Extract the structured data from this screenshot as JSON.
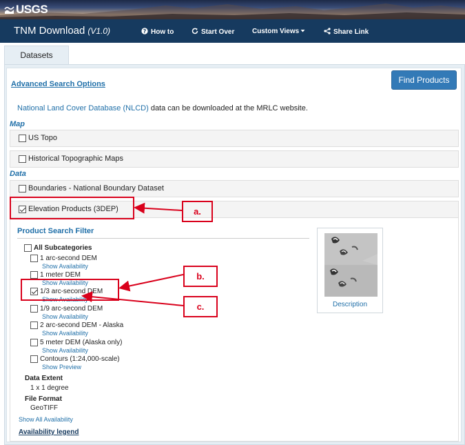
{
  "banner": {
    "logo_text": "USGS"
  },
  "nav": {
    "title": "TNM Download",
    "version": "(V1.0)",
    "links": [
      {
        "icon": "question-circle-icon",
        "label": "How to"
      },
      {
        "icon": "refresh-icon",
        "label": "Start Over"
      },
      {
        "icon": "caret-down-icon",
        "label": "Custom Views"
      },
      {
        "icon": "share-icon",
        "label": "Share Link"
      }
    ]
  },
  "tabs": {
    "datasets": "Datasets"
  },
  "toolbar": {
    "advanced_search": "Advanced Search Options",
    "find_products": "Find Products"
  },
  "nlcd": {
    "link_text": "National Land Cover Database (NLCD)",
    "rest_text": " data can be downloaded at the MRLC website."
  },
  "sections": {
    "map": "Map",
    "data": "Data"
  },
  "datasets": {
    "us_topo": {
      "label": "US Topo",
      "checked": false
    },
    "historical": {
      "label": "Historical Topographic Maps",
      "checked": false
    },
    "boundaries": {
      "label": "Boundaries - National Boundary Dataset",
      "checked": false
    },
    "elevation": {
      "label": "Elevation Products (3DEP)",
      "checked": true
    }
  },
  "filter": {
    "title": "Product Search Filter",
    "all_subcategories": "All Subcategories",
    "items": [
      {
        "label": "1 arc-second DEM",
        "link": "Show Availability",
        "checked": false
      },
      {
        "label": "1 meter DEM",
        "link": "Show Availability",
        "checked": false
      },
      {
        "label": "1/3 arc-second DEM",
        "link": "Show Availability",
        "checked": true
      },
      {
        "label": "1/9 arc-second DEM",
        "link": "Show Availability",
        "checked": false
      },
      {
        "label": "2 arc-second DEM - Alaska",
        "link": "Show Availability",
        "checked": false
      },
      {
        "label": "5 meter DEM (Alaska only)",
        "link": "Show Availability",
        "checked": false
      },
      {
        "label": "Contours (1:24,000-scale)",
        "link": "Show Preview",
        "checked": false
      }
    ],
    "data_extent_label": "Data Extent",
    "data_extent_value": "1 x 1 degree",
    "file_format_label": "File Format",
    "file_format_value": "GeoTIFF",
    "show_all": "Show All Availability",
    "legend": "Availability legend"
  },
  "thumbnail": {
    "description": "Description"
  },
  "annotations": {
    "a": "a.",
    "b": "b.",
    "c": "c."
  },
  "colors": {
    "nav": "#163a5f",
    "link": "#1f6fa8",
    "button": "#337ab7",
    "annotation": "#d9001b"
  }
}
